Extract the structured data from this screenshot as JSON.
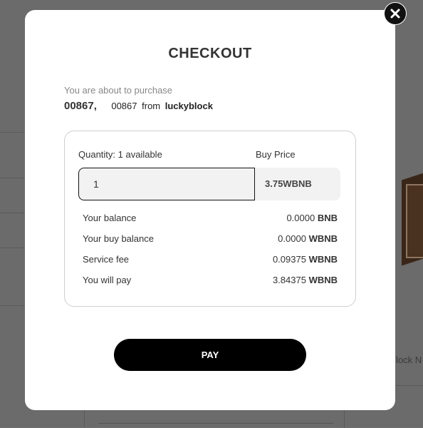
{
  "modal": {
    "title": "CHECKOUT",
    "subtitle": "You are about to purchase",
    "item_number": "00867,",
    "item_name": "00867",
    "from_label": "from",
    "seller": "luckyblock",
    "close_icon": "close-icon"
  },
  "form": {
    "quantity_label": "Quantity: 1 available",
    "buy_price_label": "Buy Price",
    "quantity_value": "1",
    "price_value": "3.75WBNB"
  },
  "summary": [
    {
      "label": "Your balance",
      "amount": "0.0000",
      "currency": "BNB"
    },
    {
      "label": "Your buy balance",
      "amount": "0.0000",
      "currency": "WBNB"
    },
    {
      "label": "Service fee",
      "amount": "0.09375",
      "currency": "WBNB"
    },
    {
      "label": "You will pay",
      "amount": "3.84375",
      "currency": "WBNB"
    }
  ],
  "pay_label": "PAY",
  "background": {
    "partial_text": "lock N"
  }
}
